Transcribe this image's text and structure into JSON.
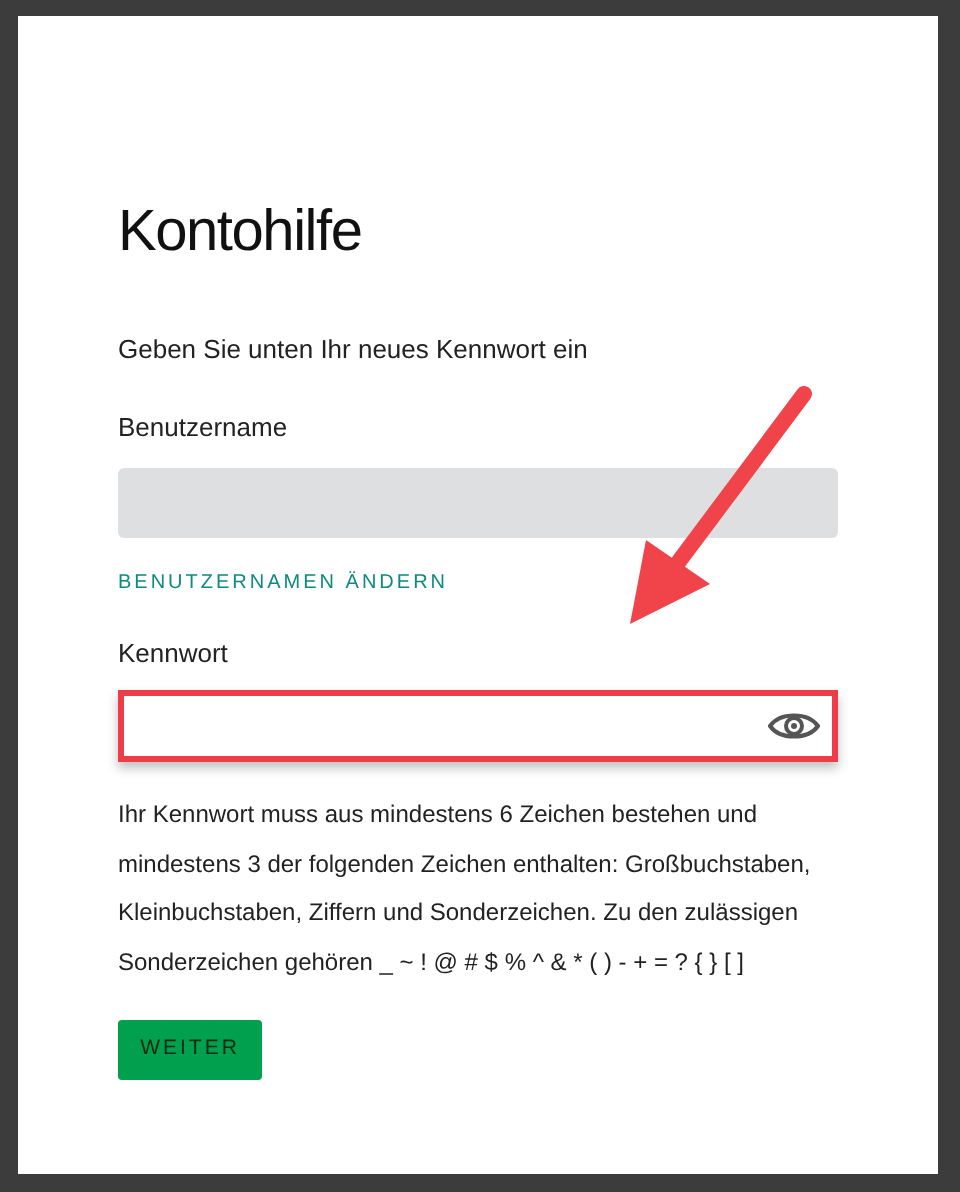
{
  "title": "Kontohilfe",
  "subtitle": "Geben Sie unten Ihr neues Kennwort ein",
  "username": {
    "label": "Benutzername",
    "disabled": true
  },
  "change_username_link": "BENUTZERNAMEN ÄNDERN",
  "password": {
    "label": "Kennwort",
    "highlighted": true,
    "show_password_toggle": true
  },
  "hint": "Ihr Kennwort muss aus mindestens 6 Zeichen bestehen und mindestens 3 der folgenden Zeichen enthalten: Großbuchstaben, Kleinbuchstaben, Ziffern und Sonderzeichen. Zu den zulässigen Sonderzeichen gehören _ ~ ! @ # $ % ^ & * ( ) - + = ? { } [ ]",
  "button": "WEITER",
  "annotation_arrow": true
}
